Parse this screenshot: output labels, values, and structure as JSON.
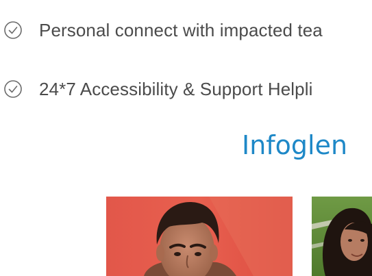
{
  "features": [
    {
      "icon": "check-circle-icon",
      "text": "Personal connect with impacted tea"
    },
    {
      "icon": "check-circle-icon",
      "text": "24*7 Accessibility & Support Helpli"
    }
  ],
  "section": {
    "title": "Infoglen"
  },
  "colors": {
    "icon_stroke": "#6b6b6b",
    "feature_text": "#4b4b4b",
    "title": "#1e88c7"
  }
}
